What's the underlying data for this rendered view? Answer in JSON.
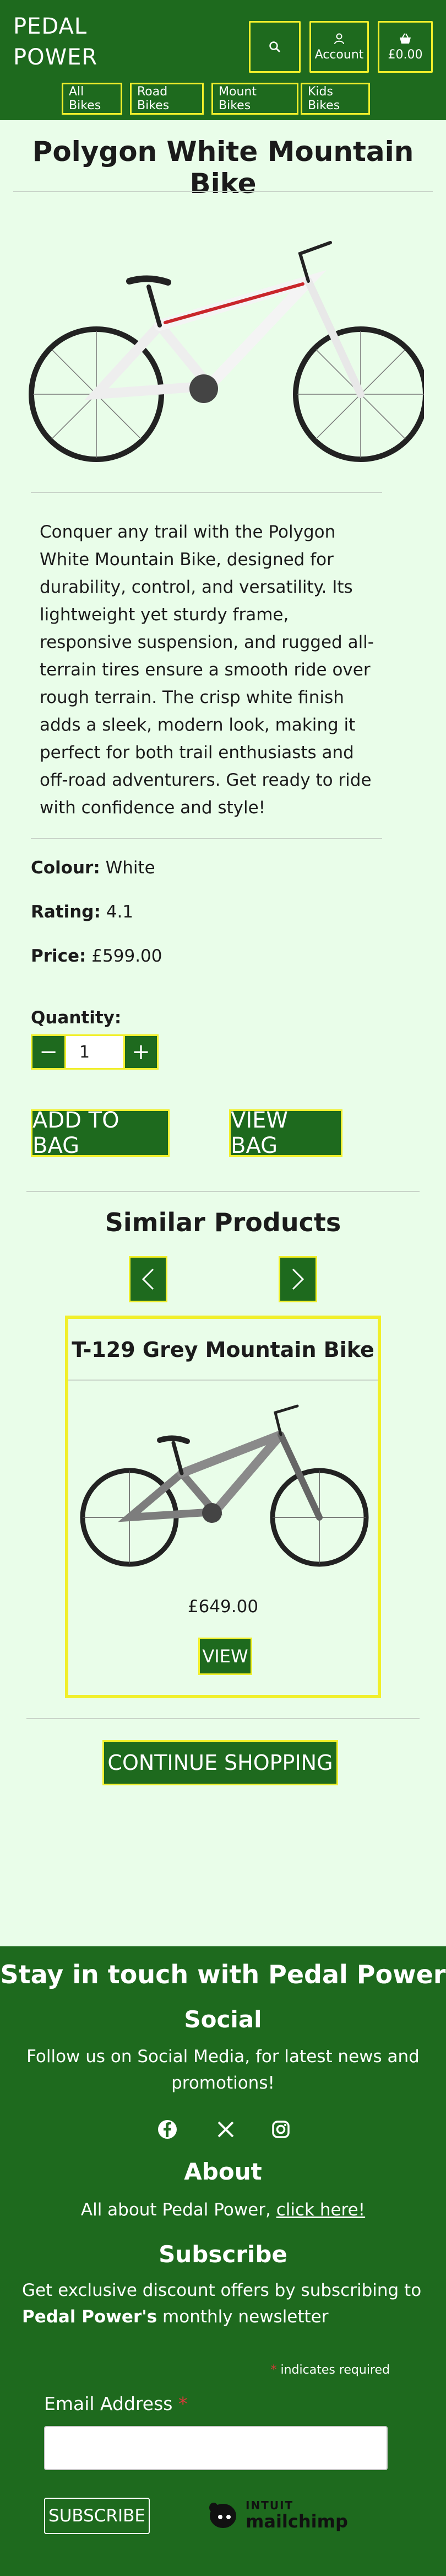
{
  "header": {
    "brand_line1": "PEDAL",
    "brand_line2": "POWER",
    "account_label": "Account",
    "cart_total": "£0.00",
    "nav": [
      "All Bikes",
      "Road Bikes",
      "Mount Bikes",
      "Kids Bikes"
    ]
  },
  "product": {
    "title": "Polygon White Mountain Bike",
    "description": "Conquer any trail with the Polygon White Mountain Bike, designed for durability, control, and versatility. Its lightweight yet sturdy frame, responsive suspension, and rugged all-terrain tires ensure a smooth ride over rough terrain. The crisp white finish adds a sleek, modern look, making it perfect for both trail enthusiasts and off-road adventurers. Get ready to ride with confidence and style!",
    "colour_label": "Colour:",
    "colour_value": "White",
    "rating_label": "Rating:",
    "rating_value": "4.1",
    "price_label": "Price:",
    "price_value": "£599.00",
    "quantity_label": "Quantity:",
    "quantity_value": "1",
    "minus": "−",
    "plus": "+",
    "add_to_bag": "ADD TO BAG",
    "view_bag": "VIEW BAG"
  },
  "similar": {
    "heading": "Similar Products",
    "card_title": "T-129 Grey Mountain Bike",
    "card_price": "£649.00",
    "card_button": "VIEW"
  },
  "continue_shopping": "CONTINUE SHOPPING",
  "footer": {
    "heading": "Stay in touch with Pedal Power",
    "social_heading": "Social",
    "social_text": "Follow us on Social Media, for latest news and promotions!",
    "social_icons": [
      "facebook-icon",
      "x-icon",
      "instagram-icon"
    ],
    "about_heading": "About",
    "about_text": "All about Pedal Power, ",
    "about_link": "click here!",
    "subscribe_heading": "Subscribe",
    "subscribe_text_1": "Get exclusive discount offers by subscribing to",
    "subscribe_text_bold": "Pedal Power's",
    "subscribe_text_2": " monthly newsletter",
    "required_asterisk": "*",
    "required_note": " indicates required",
    "email_label": "Email Address ",
    "subscribe_button": "SUBSCRIBE",
    "mailchimp_line1": "INTUIT",
    "mailchimp_line2": "mailchimp"
  },
  "colors": {
    "brand_green": "#1e6a1e",
    "accent_yellow": "#f1ef2b",
    "page_bg": "#e9fde9",
    "required_red": "#d83a3a"
  }
}
